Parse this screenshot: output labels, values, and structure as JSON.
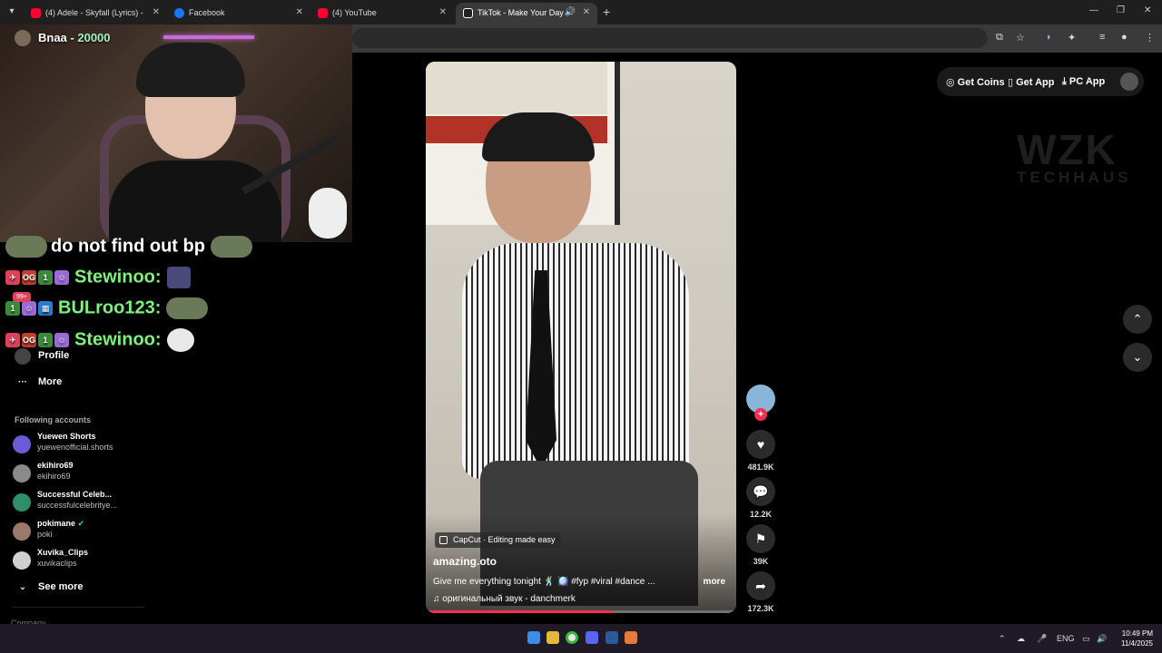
{
  "browser": {
    "tabs": [
      {
        "title": "(4) Adele - Skyfall (Lyrics) - YouTube",
        "favicon_color": "#ff0033"
      },
      {
        "title": "Facebook",
        "favicon_color": "#1877f2"
      },
      {
        "title": "(4) YouTube",
        "favicon_color": "#ff0033"
      },
      {
        "title": "TikTok - Make Your Day",
        "favicon_color": "#ffffff"
      }
    ],
    "new_tab_icon": "plus-icon"
  },
  "tiktok": {
    "top_actions": {
      "coins": "Get Coins",
      "app": "Get App",
      "pc_app": "PC App"
    },
    "watermark": {
      "line1": "WZK",
      "line2": "TECHHAUS"
    },
    "sidebar": {
      "items": [
        {
          "label": "Profile",
          "icon": "profile-icon"
        },
        {
          "label": "More",
          "icon": "more-icon"
        }
      ],
      "following_header": "Following accounts",
      "accounts": [
        {
          "name": "Yuewen Shorts",
          "handle": "yuewenofficial.shorts",
          "color": "#6b5bd6"
        },
        {
          "name": "ekihiro69",
          "handle": "ekihiro69",
          "color": "#8a8a8a"
        },
        {
          "name": "Successful Celeb...",
          "handle": "successfulcelebritye...",
          "color": "#2f8f6a"
        },
        {
          "name": "pokimane",
          "handle": "poki",
          "color": "#9a7a6a",
          "verified": true
        },
        {
          "name": "Xuvika_Clips",
          "handle": "xuvikaclips",
          "color": "#d0d0d0"
        }
      ],
      "see_more": "See more",
      "company": "Company"
    },
    "video": {
      "capcut": "CapCut · Editing made easy",
      "author": "amazing.oto",
      "description": "Give me everything tonight 🕺 🪩 #fyp #viral #dance ...",
      "more": "more",
      "music": "♫  оригинальный звук - danchmerk",
      "progress": 0.6
    },
    "actions": {
      "likes": "481.9K",
      "comments": "12.2K",
      "saves": "39K",
      "shares": "172.3K"
    }
  },
  "stream_overlay": {
    "streamer": "B",
    "streamer_suffix": "naa",
    "count": "20000",
    "headline": "do not find out bp",
    "chat": [
      {
        "user": "Stewinoo:"
      },
      {
        "user": "BULroo123:"
      },
      {
        "user": "Stewinoo:"
      }
    ],
    "badge_count": "99+"
  },
  "taskbar": {
    "lang": "ENG",
    "time": "10:49 PM",
    "date": "11/4/2025"
  }
}
